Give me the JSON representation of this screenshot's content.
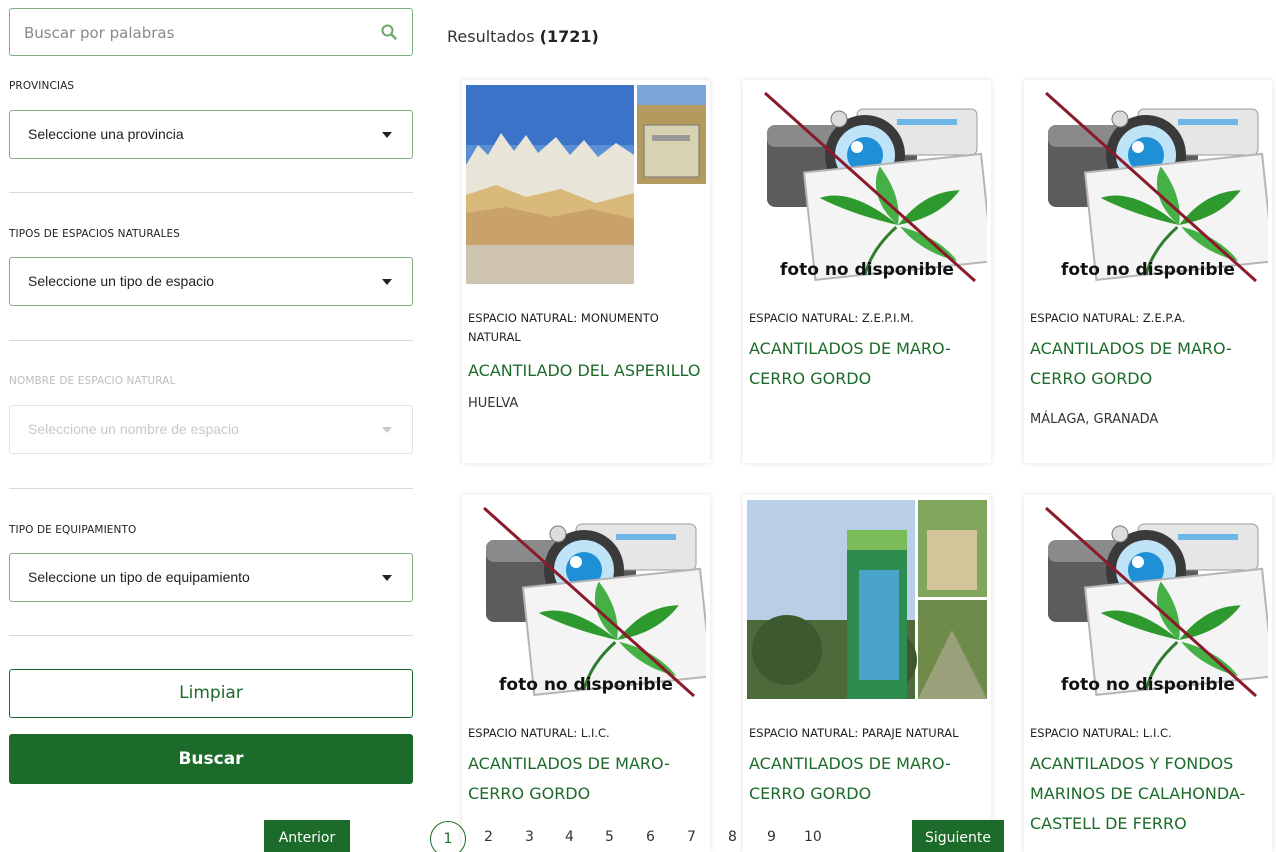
{
  "search": {
    "placeholder": "Buscar por palabras",
    "icon": "search-icon"
  },
  "filters": {
    "provincias": {
      "label": "PROVINCIAS",
      "value": "Seleccione una provincia"
    },
    "tipos": {
      "label": "TIPOS DE ESPACIOS NATURALES",
      "value": "Seleccione un tipo de espacio"
    },
    "nombre": {
      "label": "NOMBRE DE ESPACIO NATURAL",
      "value": "Seleccione un nombre de espacio"
    },
    "equipamiento": {
      "label": "TIPO DE EQUIPAMIENTO",
      "value": "Seleccione un tipo de equipamiento"
    }
  },
  "buttons": {
    "clear": "Limpiar",
    "search": "Buscar"
  },
  "results": {
    "label": "Resultados",
    "count": "(1721)"
  },
  "no_photo_text": "foto no disponible",
  "cards": [
    {
      "type": "ESPACIO NATURAL: MONUMENTO NATURAL",
      "name": "ACANTILADO DEL ASPERILLO",
      "province": "HUELVA",
      "photo": "cliffs-photo"
    },
    {
      "type": "ESPACIO NATURAL: Z.E.P.I.M.",
      "name": "ACANTILADOS DE MARO-CERRO GORDO",
      "province": "",
      "photo": "no-photo"
    },
    {
      "type": "ESPACIO NATURAL: Z.E.P.A.",
      "name": "ACANTILADOS DE MARO-CERRO GORDO",
      "province": "MÁLAGA, GRANADA",
      "photo": "no-photo"
    },
    {
      "type": "ESPACIO NATURAL: L.I.C.",
      "name": "ACANTILADOS DE MARO-CERRO GORDO",
      "province": "",
      "photo": "no-photo"
    },
    {
      "type": "ESPACIO NATURAL: PARAJE NATURAL",
      "name": "ACANTILADOS DE MARO-CERRO GORDO",
      "province": "",
      "photo": "sign-photo"
    },
    {
      "type": "ESPACIO NATURAL: L.I.C.",
      "name": "ACANTILADOS Y FONDOS MARINOS DE CALAHONDA-CASTELL DE FERRO",
      "province": "",
      "photo": "no-photo"
    }
  ],
  "pagination": {
    "prev": "Anterior",
    "next": "Siguiente",
    "current": "1",
    "pages": [
      "2",
      "3",
      "4",
      "5",
      "6",
      "7",
      "8",
      "9",
      "10"
    ]
  },
  "colors": {
    "accent": "#1d6b2a",
    "border": "#7fb27f"
  }
}
